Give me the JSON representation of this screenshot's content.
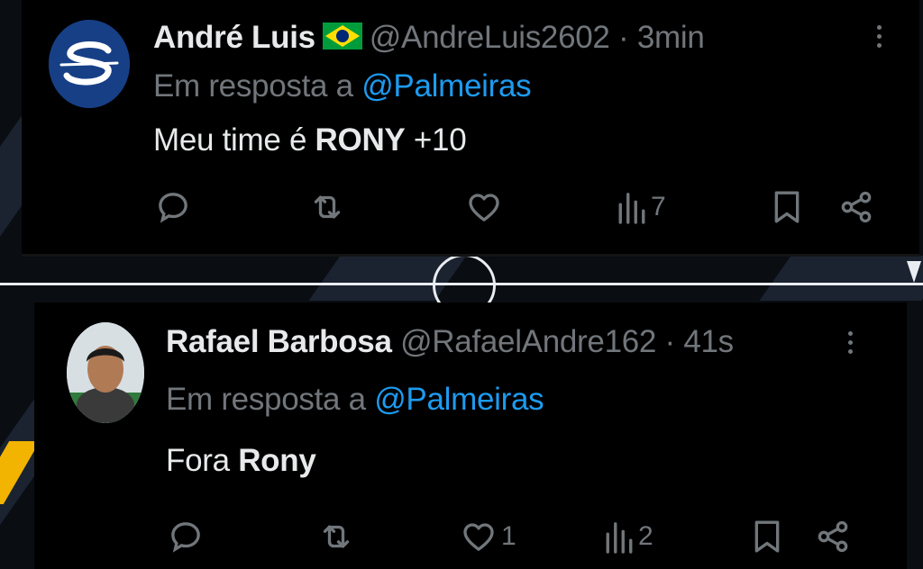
{
  "colors": {
    "background": "#000000",
    "name": "#e7e9ea",
    "muted": "#71767b",
    "link": "#1d9bf0",
    "accent_yellow": "#f2b400"
  },
  "tweets": [
    {
      "author": "André Luis",
      "handle": "@AndreLuis2602",
      "separator": "·",
      "time": "3min",
      "badge_icon": "brazil-flag-icon",
      "reply_prefix": "Em resposta a",
      "reply_mention": "@Palmeiras",
      "text_before": "Meu time é ",
      "text_bold": "RONY",
      "text_after": " +10",
      "actions": {
        "reply_count": "",
        "retweet_count": "",
        "like_count": "",
        "views_count": "7"
      }
    },
    {
      "author": "Rafael Barbosa",
      "handle": "@RafaelAndre162",
      "separator": "·",
      "time": "41s",
      "reply_prefix": "Em resposta a",
      "reply_mention": "@Palmeiras",
      "text_before": "Fora ",
      "text_bold": "Rony",
      "text_after": "",
      "actions": {
        "reply_count": "",
        "retweet_count": "",
        "like_count": "1",
        "views_count": "2"
      }
    }
  ]
}
